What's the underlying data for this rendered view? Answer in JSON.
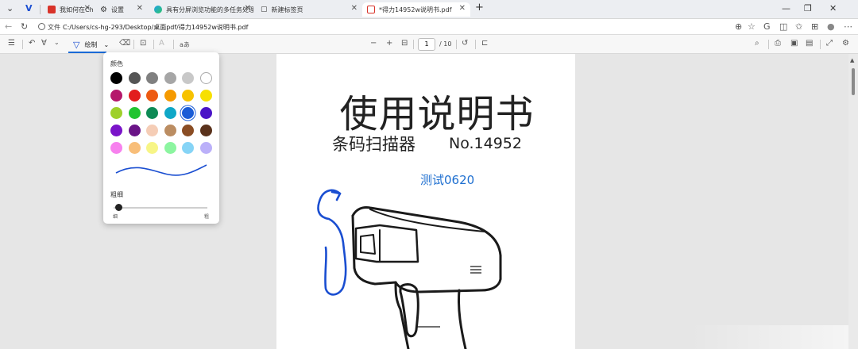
{
  "tabs": [
    {
      "label": "我如何在Ch",
      "icon": "site-51-icon",
      "color": "#d8332a"
    },
    {
      "label": "设置",
      "icon": "gear-icon"
    },
    {
      "label": "具有分屏浏览功能的多任务处理 |",
      "icon": "edge-icon"
    },
    {
      "label": "新建标签页",
      "icon": "newtab-icon"
    },
    {
      "label": "*得力14952w说明书.pdf",
      "icon": "pdf-icon",
      "active": true
    }
  ],
  "address": {
    "label": "文件",
    "url": "C:/Users/cs-hg-293/Desktop/桌面pdf/得力14952w说明书.pdf"
  },
  "toolbar": {
    "draw_label": "绘制",
    "read_label": "aあ",
    "text_label": "A",
    "page_current": "1",
    "page_total": "/ 10"
  },
  "draw_popup": {
    "color_heading": "颜色",
    "thickness_heading": "粗细",
    "thin_label": "细",
    "thick_label": "粗",
    "selected_color": "#1a5cd6",
    "colors": [
      [
        "#000000",
        "#555555",
        "#808080",
        "#a6a6a6",
        "#c8c8c8",
        "#ffffff"
      ],
      [
        "#b5186b",
        "#e21d1d",
        "#ed5a12",
        "#f59a00",
        "#f7c200",
        "#f7e000"
      ],
      [
        "#9ed02a",
        "#22c431",
        "#0d8a55",
        "#0fa7c7",
        "#1a5cd6",
        "#4a14c7"
      ],
      [
        "#7a14c9",
        "#6a1487",
        "#f5cdb6",
        "#bb8d62",
        "#8a4d24",
        "#5a321c"
      ],
      [
        "#f781ee",
        "#f8be79",
        "#f7f586",
        "#8cf5a0",
        "#86d4f6",
        "#bbb0f9"
      ]
    ]
  },
  "document": {
    "title": "使用说明书",
    "subtitle": "条码扫描器",
    "model": "No.14952",
    "annotation_text": "测试0620",
    "annotation_color": "#1e6fd0",
    "ink_color": "#1a4ed1"
  }
}
